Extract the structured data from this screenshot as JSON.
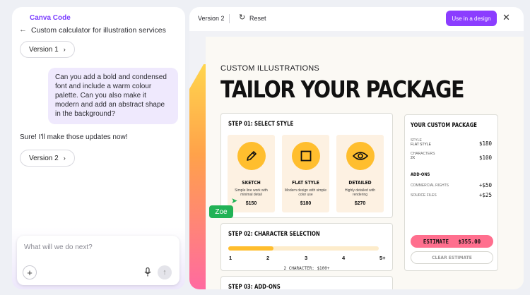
{
  "chat": {
    "brand": "Canva Code",
    "back_icon": "arrow-left-icon",
    "project_title": "Custom calculator for illustration services",
    "version1_label": "Version 1",
    "user_message": "Can you add a bold and condensed font and include a warm colour palette. Can you also make it modern and add an abstract shape in the background?",
    "assistant_reply": "Sure! I'll make those updates now!",
    "version2_label": "Version 2",
    "composer_placeholder": "What will we do next?"
  },
  "preview": {
    "version_label": "Version 2",
    "reset_label": "Reset",
    "use_button_label": "Use in a design",
    "colors": {
      "accent": "#8b3dff",
      "yellow": "#ffbe2e",
      "pink": "#ff6f8e",
      "collab": "#21b256"
    }
  },
  "page": {
    "eyebrow": "CUSTOM ILLUSTRATIONS",
    "heading": "TAILOR YOUR PACKAGE",
    "step1": {
      "title": "STEP 01: SELECT STYLE",
      "cards": [
        {
          "icon": "pencil-icon",
          "name": "SKETCH",
          "desc": "Simple line work with minimal detail",
          "price": "$150"
        },
        {
          "icon": "square-icon",
          "name": "FLAT STYLE",
          "desc": "Modern design with simple color use",
          "price": "$180"
        },
        {
          "icon": "eye-icon",
          "name": "DETAILED",
          "desc": "Highly detailed with rendering",
          "price": "$270"
        }
      ]
    },
    "step2": {
      "title": "STEP 02: CHARACTER SELECTION",
      "ticks": [
        "1",
        "2",
        "3",
        "4",
        "5+"
      ],
      "level": 0.3,
      "note": "2 CHARACTER: $100+"
    },
    "step3": {
      "title": "STEP 03: ADD-ONS"
    },
    "collaborator": "Zoe",
    "package": {
      "title": "YOUR CUSTOM PACKAGE",
      "style_label": "STYLE",
      "style_value": "FLAT STYLE",
      "style_price": "$180",
      "characters_label": "CHARACTERS",
      "characters_value": "2X",
      "characters_price": "$100",
      "addons_title": "ADD-ONS",
      "addon1_label": "COMMERCIAL RIGHTS",
      "addon1_price": "+$50",
      "addon2_label": "SOURCE FILES",
      "addon2_price": "+$25",
      "estimate_label": "ESTIMATE   $355.00",
      "clear_label": "CLEAR ESTIMATE"
    }
  }
}
